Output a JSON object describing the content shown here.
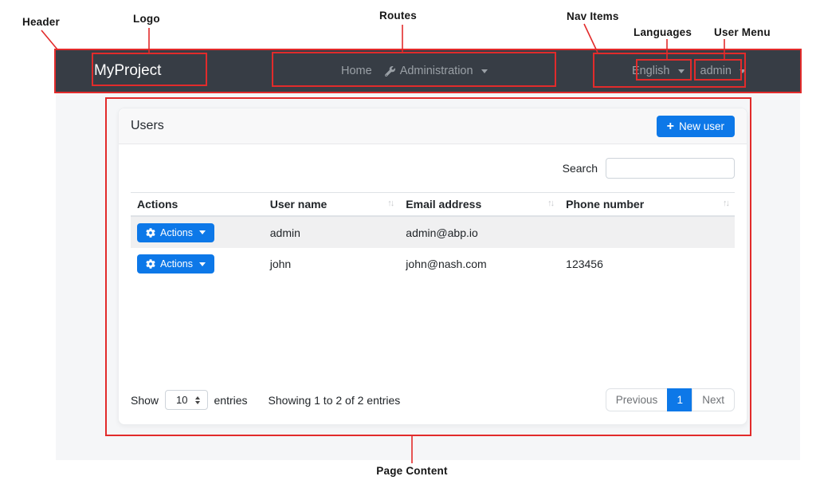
{
  "annotations": {
    "header_label": "Header",
    "logo_label": "Logo",
    "routes_label": "Routes",
    "nav_items_label": "Nav Items",
    "languages_label": "Languages",
    "user_menu_label": "User Menu",
    "page_content_label": "Page Content",
    "annotation_color": "#e22b2b"
  },
  "navbar": {
    "brand": "MyProject",
    "routes": {
      "home": "Home",
      "administration": "Administration"
    },
    "languages": "English",
    "user_menu": "admin"
  },
  "users_page": {
    "title": "Users",
    "new_user_button": "New user",
    "search_label": "Search",
    "search_value": "",
    "table": {
      "headers": [
        "Actions",
        "User name",
        "Email address",
        "Phone number"
      ],
      "rows": [
        {
          "action_label": "Actions",
          "user_name": "admin",
          "email": "admin@abp.io",
          "phone": ""
        },
        {
          "action_label": "Actions",
          "user_name": "john",
          "email": "john@nash.com",
          "phone": "123456"
        }
      ]
    },
    "footer": {
      "show_label": "Show",
      "page_size": "10",
      "entries_label": "entries",
      "info": "Showing 1 to 2 of 2 entries",
      "previous": "Previous",
      "page_1": "1",
      "next": "Next"
    }
  },
  "colors": {
    "primary_blue": "#0d78e8",
    "navbar_bg": "#373d45",
    "content_bg": "#f5f6f8",
    "annotation_red": "#e22b2b"
  }
}
